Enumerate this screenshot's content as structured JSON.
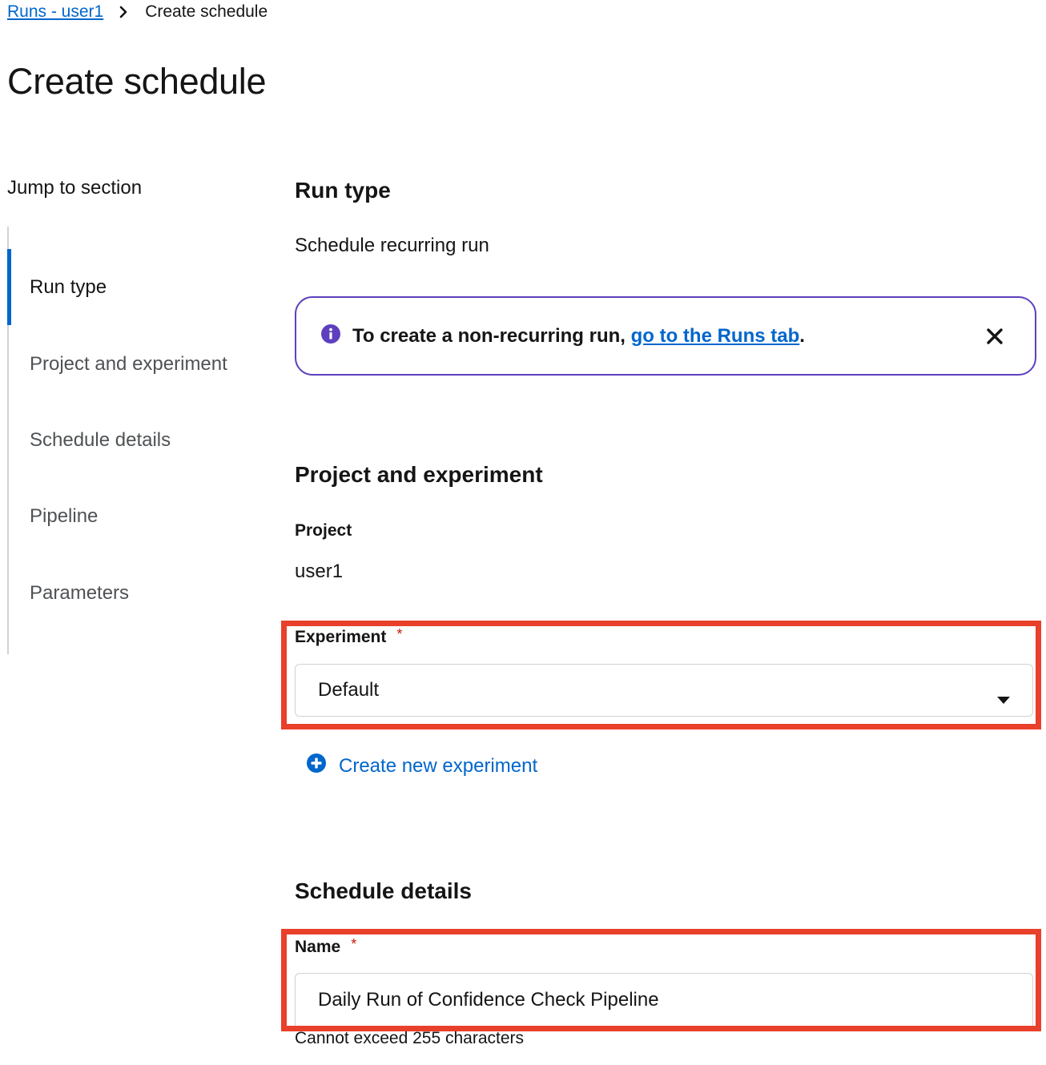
{
  "breadcrumb": {
    "parent": "Runs - user1",
    "current": "Create schedule"
  },
  "page_title": "Create schedule",
  "jump": {
    "title": "Jump to section",
    "items": [
      {
        "label": "Run type",
        "active": true
      },
      {
        "label": "Project and experiment",
        "active": false
      },
      {
        "label": "Schedule details",
        "active": false
      },
      {
        "label": "Pipeline",
        "active": false
      },
      {
        "label": "Parameters",
        "active": false
      }
    ]
  },
  "run_type": {
    "heading": "Run type",
    "value": "Schedule recurring run",
    "alert": {
      "text_prefix": "To create a non-recurring run, ",
      "link": "go to the Runs tab",
      "text_suffix": "."
    }
  },
  "project_experiment": {
    "heading": "Project and experiment",
    "project_label": "Project",
    "project_value": "user1",
    "experiment_label": "Experiment",
    "required_mark": "*",
    "experiment_value": "Default",
    "create_link": "Create new experiment"
  },
  "schedule_details": {
    "heading": "Schedule details",
    "name_label": "Name",
    "required_mark": "*",
    "name_value": "Daily Run of Confidence Check Pipeline",
    "helper": "Cannot exceed 255 characters"
  },
  "colors": {
    "link": "#0066cc",
    "active_indicator": "#0066cc",
    "alert_border": "#5e40be",
    "required": "#c9190b",
    "highlight": "#e8402a"
  }
}
